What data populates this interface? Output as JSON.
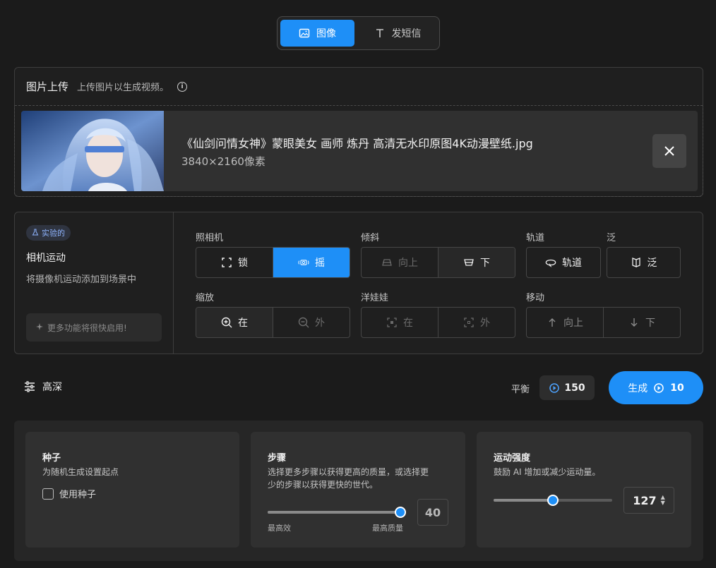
{
  "mode_toggle": {
    "image_label": "图像",
    "sms_label": "发短信",
    "active": "image"
  },
  "upload": {
    "title": "图片上传",
    "subtitle": "上传图片以生成视频。",
    "file_name": "《仙剑问情女神》蒙眼美女 画师 炼丹 高清无水印原图4K动漫壁纸.jpg",
    "file_dims": "3840×2160像素"
  },
  "camera": {
    "badge": "实验的",
    "title": "相机运动",
    "description": "将摄像机运动添加到场景中",
    "more_soon": "更多功能将很快启用!",
    "groups": {
      "camera": {
        "label": "照相机",
        "lock": "锁",
        "shake": "摇",
        "active": "shake"
      },
      "tilt": {
        "label": "倾斜",
        "up": "向上",
        "down": "下"
      },
      "orbit": {
        "label": "轨道",
        "button": "轨道"
      },
      "pan": {
        "label": "泛",
        "button": "泛"
      },
      "zoom": {
        "label": "缩放",
        "in": "在",
        "out": "外"
      },
      "doll": {
        "label": "洋娃娃",
        "in": "在",
        "out": "外"
      },
      "move": {
        "label": "移动",
        "up": "向上",
        "down": "下"
      }
    }
  },
  "settings": {
    "advanced_label": "高深",
    "balance_label": "平衡",
    "balance_value": "150",
    "generate_label": "生成",
    "generate_cost": "10"
  },
  "params": {
    "seed": {
      "title": "种子",
      "desc": "为随机生成设置起点",
      "checkbox_label": "使用种子",
      "checked": false
    },
    "steps": {
      "title": "步骤",
      "desc_line1": "选择更多步骤以获得更高的质量，或选择更",
      "desc_line2": "少的步骤以获得更快的世代。",
      "value": "40",
      "slider_fraction": 1.0,
      "min_caption": "最高效",
      "max_caption": "最高质量"
    },
    "motion": {
      "title": "运动强度",
      "desc": "鼓励 AI 增加或减少运动量。",
      "value": "127",
      "slider_fraction": 0.5
    }
  },
  "colors": {
    "accent": "#1e8ff7",
    "background": "#1b1b1b",
    "panel": "#1f1f1f",
    "card": "#303030"
  },
  "icons": {
    "image": "image-icon",
    "text": "text-t-icon",
    "info": "info-icon",
    "close": "close-icon",
    "flask": "flask-icon",
    "sparkle": "sparkle-icon",
    "sliders": "sliders-icon",
    "credit": "credit-coin-icon"
  }
}
